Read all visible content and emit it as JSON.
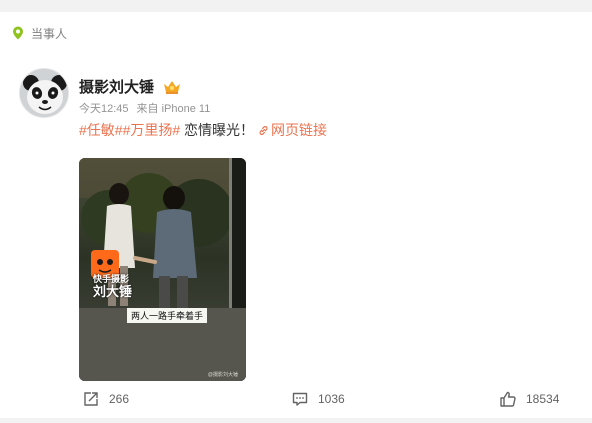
{
  "section": {
    "title": "当事人"
  },
  "post": {
    "author": "摄影刘大锤",
    "time": "今天12:45",
    "source": "来自 iPhone 11",
    "tags": [
      "#任敏#",
      "#万里扬#"
    ],
    "text": " 恋情曝光！",
    "link_label": "网页链接",
    "media": {
      "watermark_logo_line1": "快手摄影",
      "watermark_logo_line2": "刘大锤",
      "subtitle": "两人一路手牵着手",
      "corner_watermark": "@摄影刘大锤"
    }
  },
  "actions": {
    "repost_count": "266",
    "comment_count": "1036",
    "like_count": "18534"
  },
  "colors": {
    "tag": "#eb7350",
    "section_icon": "#8fc31f",
    "badge": "#f5a623"
  },
  "icons": {
    "section": "location-pin-icon",
    "badge": "crown-badge-icon",
    "link": "link-icon",
    "repost": "share-icon",
    "comment": "comment-icon",
    "like": "thumbs-up-icon"
  }
}
